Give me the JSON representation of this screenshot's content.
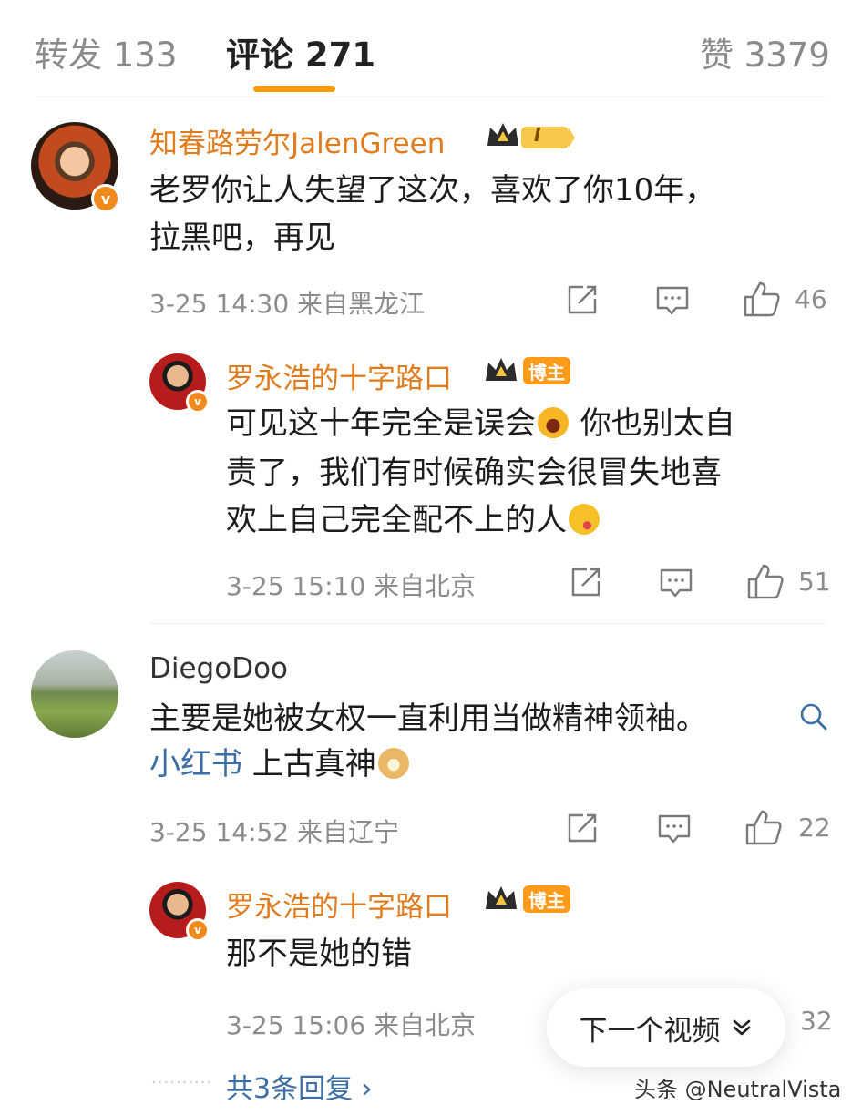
{
  "tabs": {
    "repost": "转发 133",
    "comments": "评论 271",
    "likes": "赞 3379"
  },
  "comments": [
    {
      "username": "知春路劳尔JalenGreen",
      "text_line1": "老罗你让人失望了这次，喜欢了你10年，",
      "text_line2": "拉黑吧，再见",
      "meta": "3-25 14:30 来自黑龙江",
      "likes": "46",
      "level_badge": "I",
      "reply": {
        "username": "罗永浩的十字路口",
        "tag": "博主",
        "text_line1a": "可见这十年完全是误会",
        "text_line1b": " 你也别太自",
        "text_line2": "责了，我们有时候确实会很冒失地喜",
        "text_line3": "欢上自己完全配不上的人",
        "meta": "3-25 15:10 来自北京",
        "likes": "51"
      }
    },
    {
      "username": "DiegoDoo",
      "text_line1": "主要是她被女权一直利用当做精神领袖。",
      "link_text": "小红书",
      "text_line2_rest": " 上古真神",
      "meta": "3-25 14:52 来自辽宁",
      "likes": "22",
      "reply": {
        "username": "罗永浩的十字路口",
        "tag": "博主",
        "text_line1": "那不是她的错",
        "meta": "3-25 15:06 来自北京",
        "likes": "32"
      }
    }
  ],
  "more_replies": "共3条回复 ›",
  "next_video": "下一个视频",
  "watermark": "头条 @NeutralVista",
  "icons": {
    "share": "share-icon",
    "comment": "comment-icon",
    "like": "thumbs-up-icon",
    "search": "search-icon",
    "chevron": "chevron-down-icon"
  },
  "colors": {
    "accent": "#ff9a00",
    "username": "#e07c1e",
    "link": "#3b6ea5",
    "meta": "#8c8c8c"
  }
}
